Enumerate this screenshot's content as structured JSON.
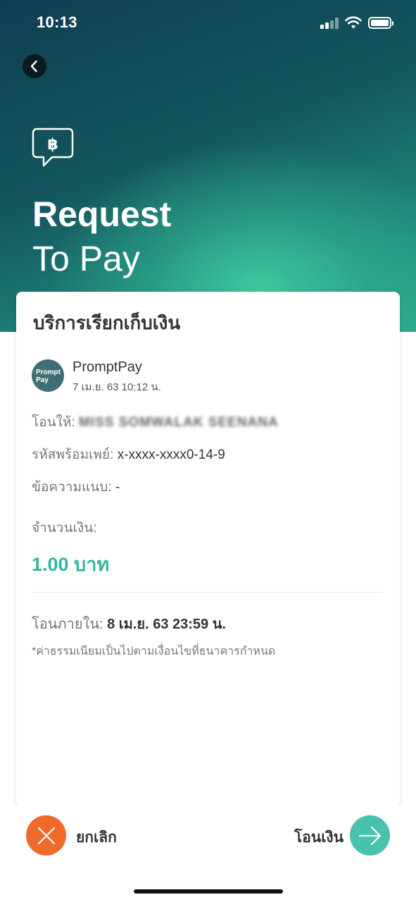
{
  "status_bar": {
    "time": "10:13"
  },
  "hero": {
    "title_bold": "Request",
    "title_light": "To Pay"
  },
  "card": {
    "title": "บริการเรียกเก็บเงิน",
    "provider": {
      "logo_text": "Prompt Pay",
      "name": "PromptPay",
      "date": "7 เม.ย. 63  10:12 น."
    },
    "recipient": {
      "label": "โอนให้: ",
      "value": "MISS SOMWALAK SEENANA"
    },
    "promptpay_id": {
      "label": "รหัสพร้อมเพย์: ",
      "value": "x-xxxx-xxxx0-14-9"
    },
    "message": {
      "label": "ข้อความแนบ: ",
      "value": "-"
    },
    "amount": {
      "label": "จำนวนเงิน:",
      "value": "1.00 บาท"
    },
    "due": {
      "label": "โอนภายใน: ",
      "value": "8 เม.ย. 63  23:59 น."
    },
    "note": "*ค่าธรรมเนียมเป็นไปตามเงื่อนไขที่ธนาคารกำหนด"
  },
  "actions": {
    "cancel_label": "ยกเลิก",
    "transfer_label": "โอนเงิน"
  },
  "colors": {
    "accent": "#35b59f",
    "cancel": "#f06a2b",
    "transfer": "#48c2ad"
  },
  "icons": [
    "back-chevron-icon",
    "baht-chat-icon",
    "close-icon",
    "arrow-right-icon",
    "signal-icon",
    "wifi-icon",
    "battery-icon"
  ]
}
